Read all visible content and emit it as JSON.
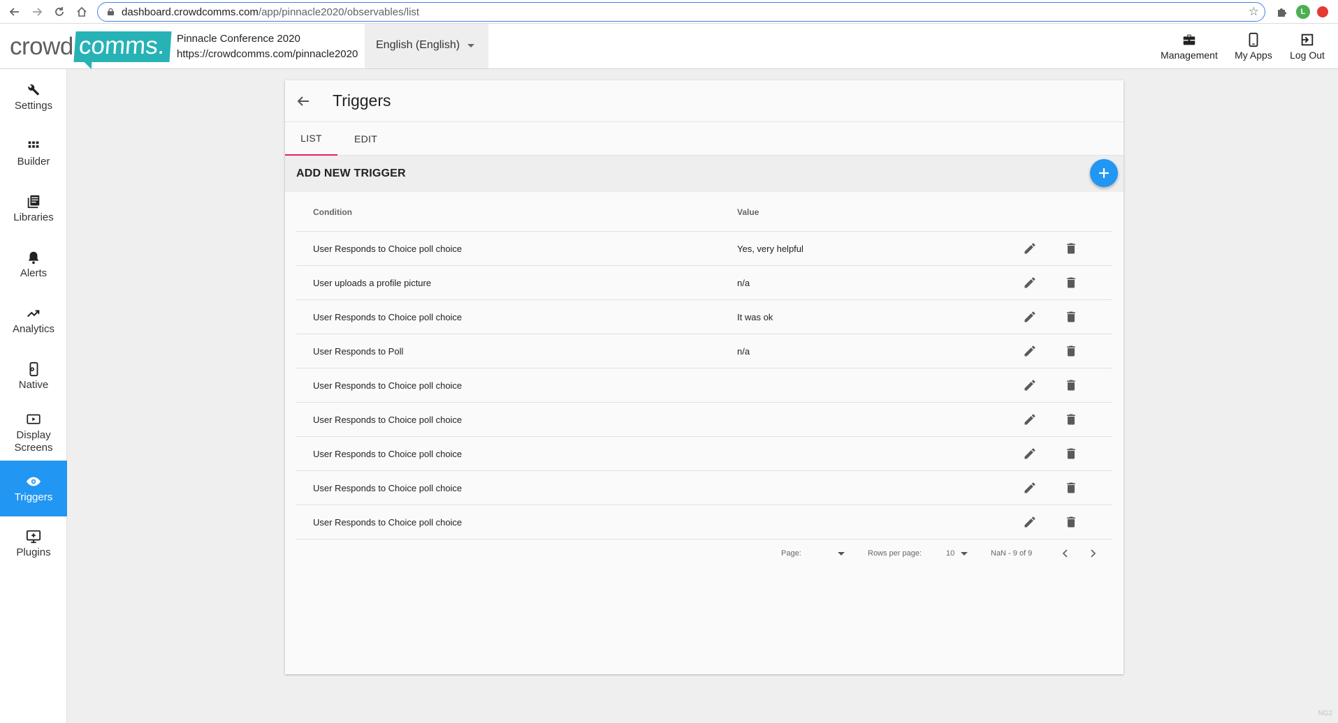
{
  "browser": {
    "url_host": "dashboard.crowdcomms.com",
    "url_path": "/app/pinnacle2020/observables/list",
    "profile_initial": "L"
  },
  "header": {
    "logo_part1": "crowd",
    "logo_part2": "comms.",
    "event_name": "Pinnacle Conference 2020",
    "event_url": "https://crowdcomms.com/pinnacle2020",
    "language": "English (English)",
    "actions": [
      {
        "label": "Management",
        "icon": "briefcase-icon"
      },
      {
        "label": "My Apps",
        "icon": "phone-icon"
      },
      {
        "label": "Log Out",
        "icon": "logout-icon"
      }
    ]
  },
  "sidebar": {
    "items": [
      {
        "label": "Settings",
        "icon": "wrench-icon"
      },
      {
        "label": "Builder",
        "icon": "grid-icon"
      },
      {
        "label": "Libraries",
        "icon": "library-icon"
      },
      {
        "label": "Alerts",
        "icon": "bell-icon"
      },
      {
        "label": "Analytics",
        "icon": "trending-icon"
      },
      {
        "label": "Native",
        "icon": "mobile-settings-icon"
      },
      {
        "label": "Display Screens",
        "icon": "display-icon"
      },
      {
        "label": "Triggers",
        "icon": "eye-icon",
        "active": true
      },
      {
        "label": "Plugins",
        "icon": "plugin-icon"
      }
    ]
  },
  "page": {
    "title": "Triggers",
    "tabs": [
      "LIST",
      "EDIT"
    ],
    "active_tab": "LIST",
    "add_label": "ADD NEW TRIGGER"
  },
  "table": {
    "columns": [
      "Condition",
      "Value"
    ],
    "rows": [
      {
        "condition": "User Responds to Choice poll choice",
        "value": "Yes, very helpful"
      },
      {
        "condition": "User uploads a profile picture",
        "value": "n/a"
      },
      {
        "condition": "User Responds to Choice poll choice",
        "value": "It was ok"
      },
      {
        "condition": "User Responds to Poll",
        "value": "n/a"
      },
      {
        "condition": "User Responds to Choice poll choice",
        "value": ""
      },
      {
        "condition": "User Responds to Choice poll choice",
        "value": ""
      },
      {
        "condition": "User Responds to Choice poll choice",
        "value": ""
      },
      {
        "condition": "User Responds to Choice poll choice",
        "value": ""
      },
      {
        "condition": "User Responds to Choice poll choice",
        "value": ""
      }
    ]
  },
  "pager": {
    "page_label": "Page:",
    "rows_label": "Rows per page:",
    "rows_value": "10",
    "range": "NaN - 9 of 9"
  },
  "footer": {
    "version": "NG2"
  },
  "colors": {
    "accent": "#2196f3",
    "brand_teal": "#27b2b6",
    "tab_indicator": "#e91e63"
  }
}
